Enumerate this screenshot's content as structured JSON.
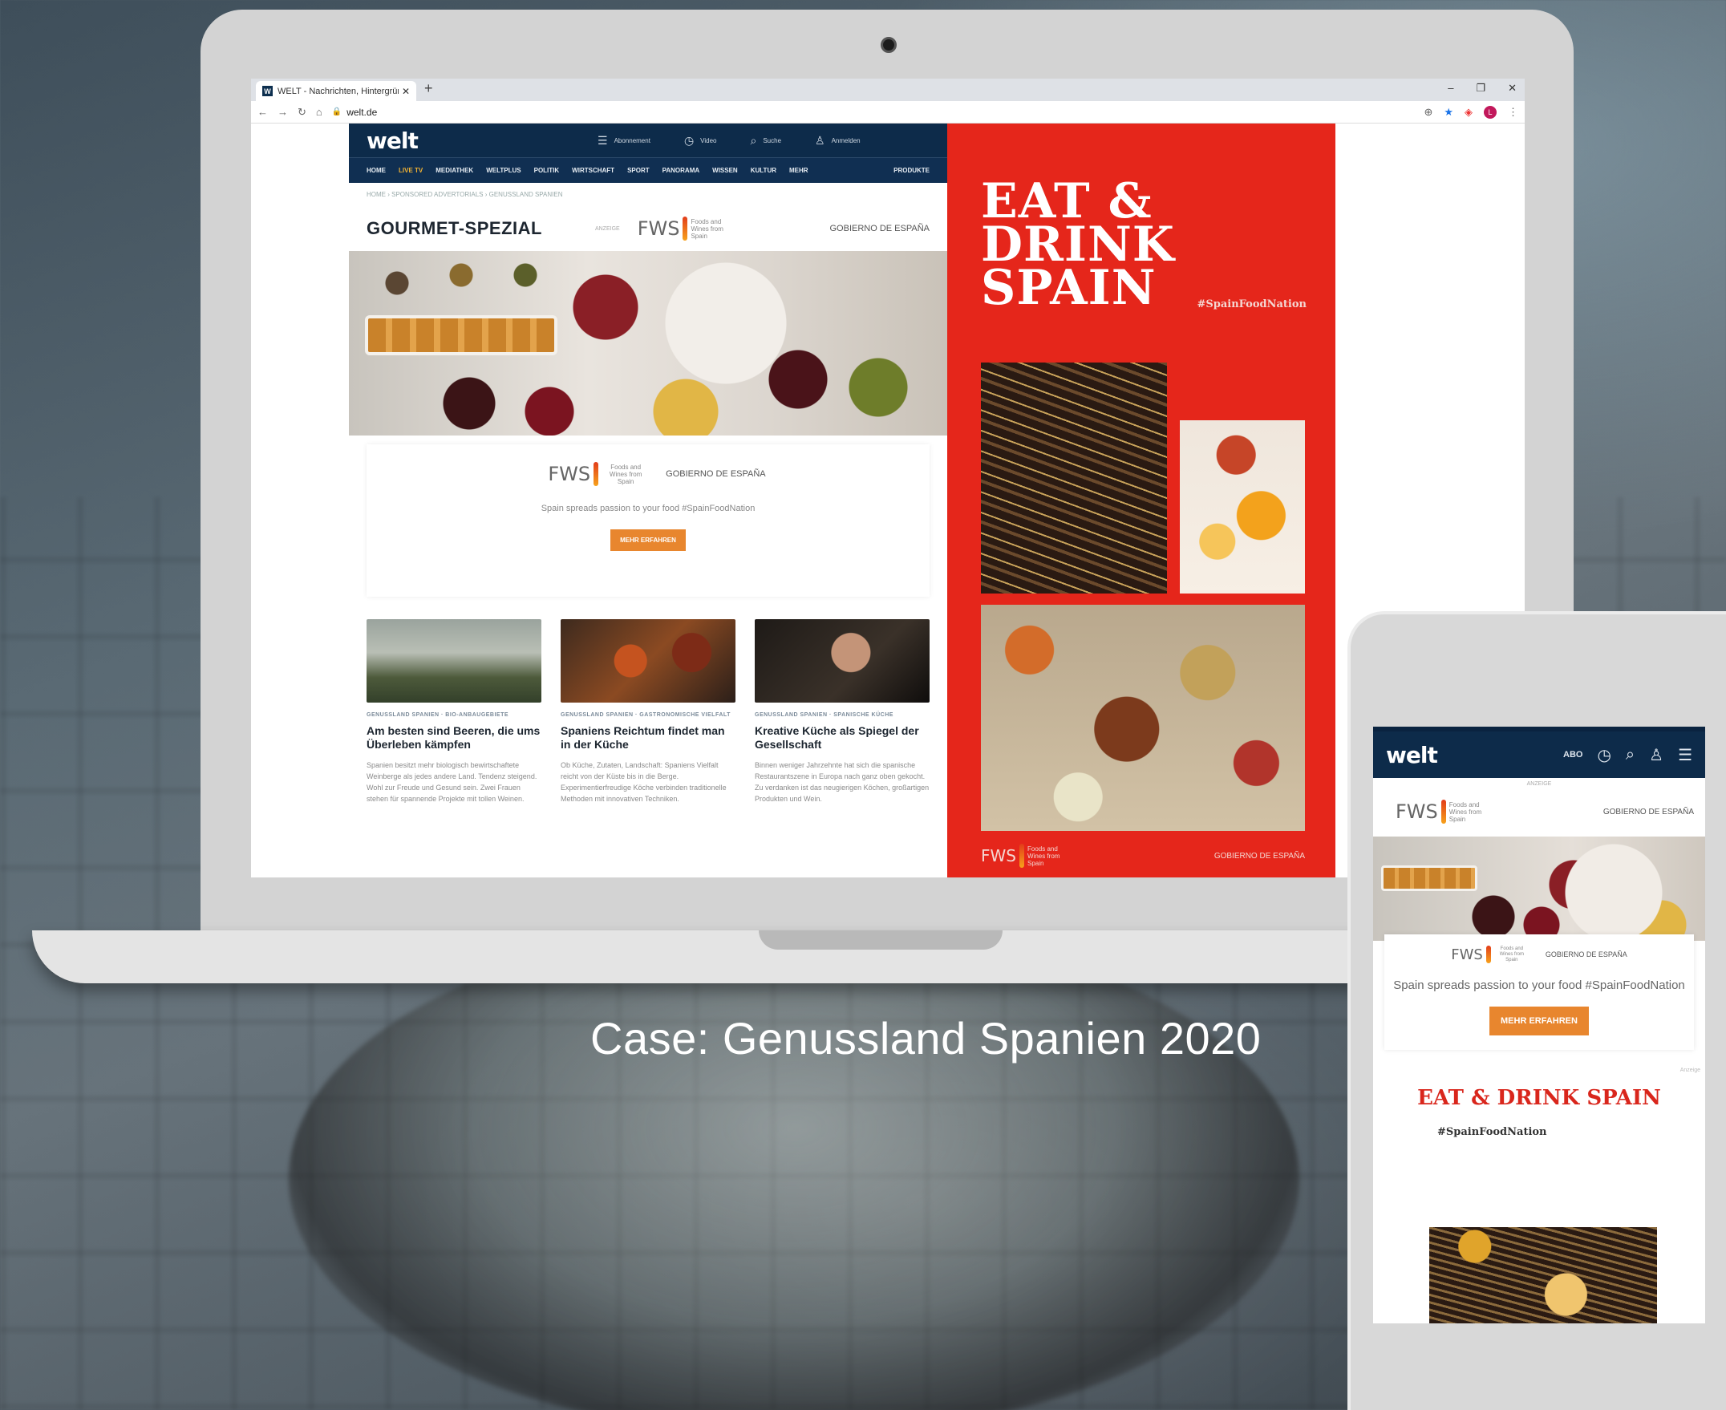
{
  "caption": "Case: Genussland Spanien 2020",
  "browser": {
    "tab_title": "WELT - Nachrichten, Hintergründe",
    "favicon": "W",
    "tab_close": "✕",
    "new_tab": "+",
    "url": "welt.de",
    "profile_initial": "L"
  },
  "site": {
    "logo": "welt",
    "header_items": [
      {
        "icon": "menu-icon",
        "label": "Abonnement"
      },
      {
        "icon": "timer-icon",
        "label": "Video"
      },
      {
        "icon": "search-icon",
        "label": "Suche"
      },
      {
        "icon": "user-icon",
        "label": "Anmelden"
      }
    ],
    "nav": [
      "HOME",
      "LIVE TV",
      "MEDIATHEK",
      "WELTPLUS",
      "POLITIK",
      "WIRTSCHAFT",
      "SPORT",
      "PANORAMA",
      "WISSEN",
      "KULTUR",
      "MEHR"
    ],
    "nav_right": "PRODUKTE",
    "breadcrumb": "HOME › SPONSORED ADVERTORIALS › GENUSSLAND SPANIEN",
    "section_title": "GOURMET-SPEZIAL",
    "anzeige": "ANZEIGE",
    "fws_mark": "FWS",
    "fws_sub": "Foods and Wines from Spain",
    "spain_gov": "GOBIERNO DE ESPAÑA",
    "promo_text": "Spain spreads passion to your food #SpainFoodNation",
    "promo_button": "MEHR ERFAHREN",
    "cards": [
      {
        "kicker": "GENUSSLAND SPANIEN · BIO-ANBAUGEBIETE",
        "title": "Am besten sind Beeren, die ums Überleben kämpfen",
        "body": "Spanien besitzt mehr biologisch bewirtschaftete Weinberge als jedes andere Land. Tendenz steigend. Wohl zur Freude und Gesund sein. Zwei Frauen stehen für spannende Projekte mit tollen Weinen."
      },
      {
        "kicker": "GENUSSLAND SPANIEN · GASTRONOMISCHE VIELFALT",
        "title": "Spaniens Reichtum findet man in der Küche",
        "body": "Ob Küche, Zutaten, Landschaft: Spaniens Vielfalt reicht von der Küste bis in die Berge. Experimentierfreudige Köche verbinden traditionelle Methoden mit innovativen Techniken."
      },
      {
        "kicker": "GENUSSLAND SPANIEN · SPANISCHE KÜCHE",
        "title": "Kreative Küche als Spiegel der Gesellschaft",
        "body": "Binnen weniger Jahrzehnte hat sich die spanische Restaurantszene in Europa nach ganz oben gekocht. Zu verdanken ist das neugierigen Köchen, großartigen Produkten und Wein."
      }
    ]
  },
  "ad": {
    "title": "EAT &\nDRINK\nSPAIN",
    "hashtag": "#SpainFoodNation",
    "fws_mark": "FWS",
    "fws_sub": "Foods and Wines from Spain",
    "gov": "GOBIERNO DE ESPAÑA"
  },
  "mobile": {
    "logo": "welt",
    "abo": "ABO",
    "anzeige": "ANZEIGE",
    "fws_mark": "FWS",
    "fws_sub": "Foods and Wines from Spain",
    "spain_gov": "GOBIERNO DE ESPAÑA",
    "promo_text": "Spain spreads passion to your food #SpainFoodNation",
    "promo_button": "MEHR ERFAHREN",
    "ad_label": "Anzeige",
    "ad_title": "EAT & DRINK SPAIN",
    "ad_hash": "#SpainFoodNation"
  }
}
